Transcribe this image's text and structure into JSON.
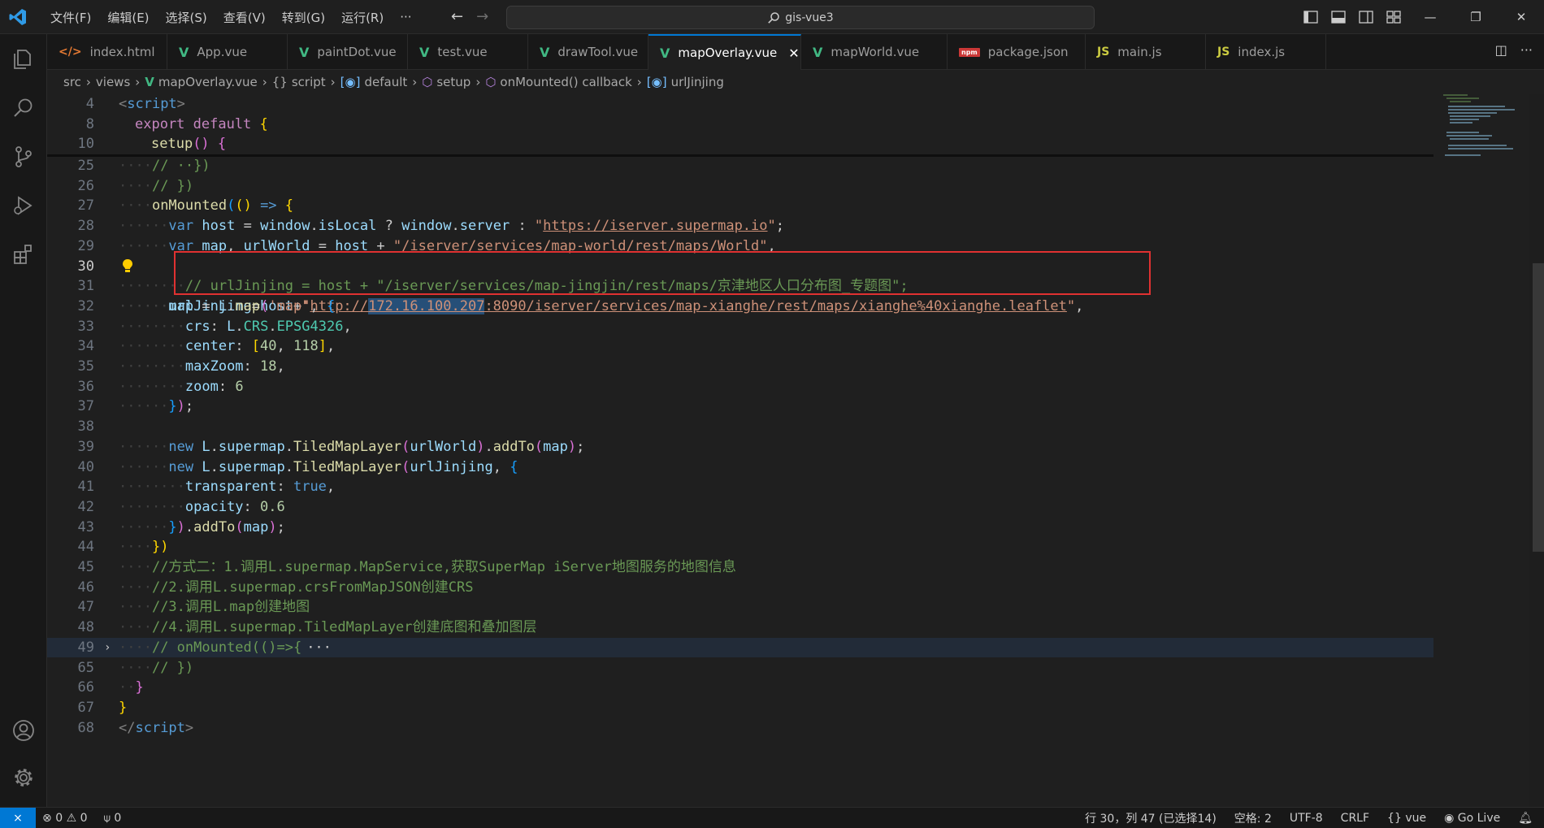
{
  "titlebar": {
    "menu": [
      "文件(F)",
      "编辑(E)",
      "选择(S)",
      "查看(V)",
      "转到(G)",
      "运行(R)",
      "···"
    ],
    "search": "gis-vue3"
  },
  "tabs": [
    {
      "label": "index.html",
      "icon": "html-icon"
    },
    {
      "label": "App.vue",
      "icon": "vue-icon"
    },
    {
      "label": "paintDot.vue",
      "icon": "vue-icon"
    },
    {
      "label": "test.vue",
      "icon": "vue-icon"
    },
    {
      "label": "drawTool.vue",
      "icon": "vue-icon"
    },
    {
      "label": "mapOverlay.vue",
      "icon": "vue-icon",
      "active": true
    },
    {
      "label": "mapWorld.vue",
      "icon": "vue-icon"
    },
    {
      "label": "package.json",
      "icon": "npm-icon"
    },
    {
      "label": "main.js",
      "icon": "js-icon"
    },
    {
      "label": "index.js",
      "icon": "js-icon"
    }
  ],
  "breadcrumb": {
    "src": "src",
    "views": "views",
    "file": "mapOverlay.vue",
    "script": "script",
    "default": "default",
    "setup": "setup",
    "onmounted": "onMounted() callback",
    "var": "urlJinjing"
  },
  "line_numbers": [
    "4",
    "8",
    "10",
    "25",
    "26",
    "27",
    "28",
    "29",
    "30",
    "31",
    "32",
    "33",
    "34",
    "35",
    "36",
    "37",
    "38",
    "39",
    "40",
    "41",
    "42",
    "43",
    "44",
    "45",
    "46",
    "47",
    "48",
    "49",
    "65",
    "66",
    "67",
    "68"
  ],
  "code": {
    "l28_url": "https://iserver.supermap.io",
    "l29_path": "/iserver/services/map-world/rest/maps/World",
    "l30_pre": "http://",
    "l30_ip": "172.16.100.207",
    "l30_post": ":8090/iserver/services/map-xianghe/rest/maps/xianghe%40xianghe.leaflet",
    "l31": "// urlJinjing = host + \"/iserver/services/map-jingjin/rest/maps/京津地区人口分布图_专题图\";",
    "l45": "//方式二：1.调用L.supermap.MapService,获取SuperMap iServer地图服务的地图信息",
    "l46": "//2.调用L.supermap.crsFromMapJSON创建CRS",
    "l47": "//3.调用L.map创建地图",
    "l48": "//4.调用L.supermap.TiledMapLayer创建底图和叠加图层",
    "l49": "// onMounted(()=>{",
    "l49_ellipsis": "···"
  },
  "statusbar": {
    "errors": "0",
    "warnings": "0",
    "ports": "0",
    "position": "行 30，列 47 (已选择14)",
    "spaces": "空格: 2",
    "encoding": "UTF-8",
    "eol": "CRLF",
    "language": "vue",
    "golive": "Go Live"
  },
  "colors": {
    "accent": "#0078d4",
    "highlight_box": "#e03131",
    "vue_green": "#41b883"
  }
}
